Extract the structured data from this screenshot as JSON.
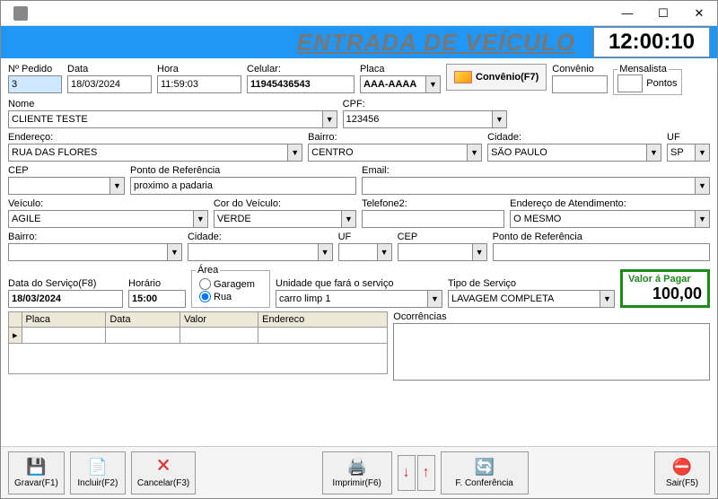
{
  "window": {
    "title": ""
  },
  "header": {
    "title": "ENTRADA DE VEÍCULO",
    "clock": "12:00:10"
  },
  "labels": {
    "pedido": "Nº Pedido",
    "data": "Data",
    "hora": "Hora",
    "celular": "Celular:",
    "placa": "Placa",
    "convenio_btn": "Convênio(F7)",
    "convenio": "Convênio",
    "mensalista": "Mensalista",
    "pontos": "Pontos",
    "nome": "Nome",
    "cpf": "CPF:",
    "endereco": "Endereço:",
    "bairro": "Bairro:",
    "cidade": "Cidade:",
    "uf": "UF",
    "cep": "CEP",
    "ponto_ref": "Ponto de Referência",
    "email": "Email:",
    "veiculo": "Veículo:",
    "cor": "Cor do Veículo:",
    "tel2": "Telefone2:",
    "end_atend": "Endereço de Atendimento:",
    "bairro2": "Bairro:",
    "cidade2": "Cidade:",
    "uf2": "UF",
    "cep2": "CEP",
    "ponto_ref2": "Ponto de Referência",
    "data_serv": "Data do Serviço(F8)",
    "horario": "Horário",
    "area": "Área",
    "garagem": "Garagem",
    "rua": "Rua",
    "unidade": "Unidade que fará o serviço",
    "tipo_serv": "Tipo de Serviço",
    "valor": "Valor á Pagar",
    "ocorrencias": "Ocorrências",
    "grid": {
      "placa": "Placa",
      "data": "Data",
      "valor": "Valor",
      "endereco": "Endereco"
    }
  },
  "values": {
    "pedido": "3",
    "data": "18/03/2024",
    "hora": "11:59:03",
    "celular": "11945436543",
    "placa": "AAA-AAAA",
    "convenio": "",
    "pontos": "",
    "nome": "CLIENTE TESTE",
    "cpf": "123456",
    "endereco": "RUA DAS FLORES",
    "bairro": "CENTRO",
    "cidade": "SÃO PAULO",
    "uf": "SP",
    "cep": "",
    "ponto_ref": "proximo a padaria",
    "email": "",
    "veiculo": "AGILE",
    "cor": "VERDE",
    "tel2": "",
    "end_atend": "O MESMO",
    "bairro2": "",
    "cidade2": "",
    "uf2": "",
    "cep2": "",
    "ponto_ref2": "",
    "data_serv": "18/03/2024",
    "horario": "15:00",
    "area": "rua",
    "unidade": "carro limp 1",
    "tipo_serv": "LAVAGEM COMPLETA",
    "valor": "100,00",
    "ocorrencias": ""
  },
  "footer": {
    "gravar": "Gravar(F1)",
    "incluir": "Incluir(F2)",
    "cancelar": "Cancelar(F3)",
    "imprimir": "Imprimir(F6)",
    "conferencia": "F. Conferência",
    "sair": "Sair(F5)"
  }
}
